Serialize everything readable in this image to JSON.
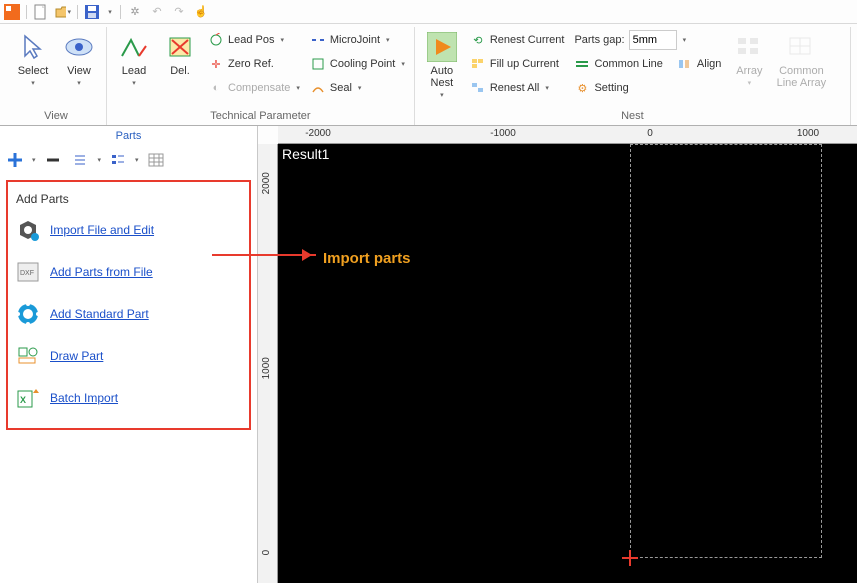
{
  "qat": {
    "items": [
      "app-logo",
      "sep",
      "new",
      "open",
      "sep",
      "save",
      "save-drop",
      "sep",
      "gear",
      "undo",
      "redo",
      "hand"
    ]
  },
  "ribbon": {
    "view": {
      "select": "Select",
      "view": "View",
      "label": "View"
    },
    "tech": {
      "lead": "Lead",
      "del": "Del.",
      "leadpos": "Lead Pos",
      "zeroref": "Zero Ref.",
      "compensate": "Compensate",
      "microjoint": "MicroJoint",
      "coolingpoint": "Cooling Point",
      "seal": "Seal",
      "label": "Technical Parameter"
    },
    "nest": {
      "autonest": "Auto\nNest",
      "renestcurrent": "Renest Current",
      "fillupcurrent": "Fill up Current",
      "renestall": "Renest All",
      "partsgap": "Parts gap:",
      "gapval": "5mm",
      "commonline": "Common Line",
      "align": "Align",
      "setting": "Setting",
      "array": "Array",
      "commonlinearray": "Common\nLine Array",
      "label": "Nest"
    }
  },
  "sidepanel": {
    "title": "Parts",
    "addparts": {
      "heading": "Add Parts",
      "importedit": "Import File and Edit",
      "addfromfile": "Add Parts from File",
      "addstandard": "Add Standard Part",
      "drawpart": "Draw Part",
      "batchimport": "Batch Import"
    }
  },
  "canvas": {
    "result": "Result1",
    "annotation": "Import parts",
    "hticks": [
      "-2000",
      "-1000",
      "0",
      "1000"
    ],
    "vticks": [
      "2000",
      "1000",
      "0"
    ]
  }
}
